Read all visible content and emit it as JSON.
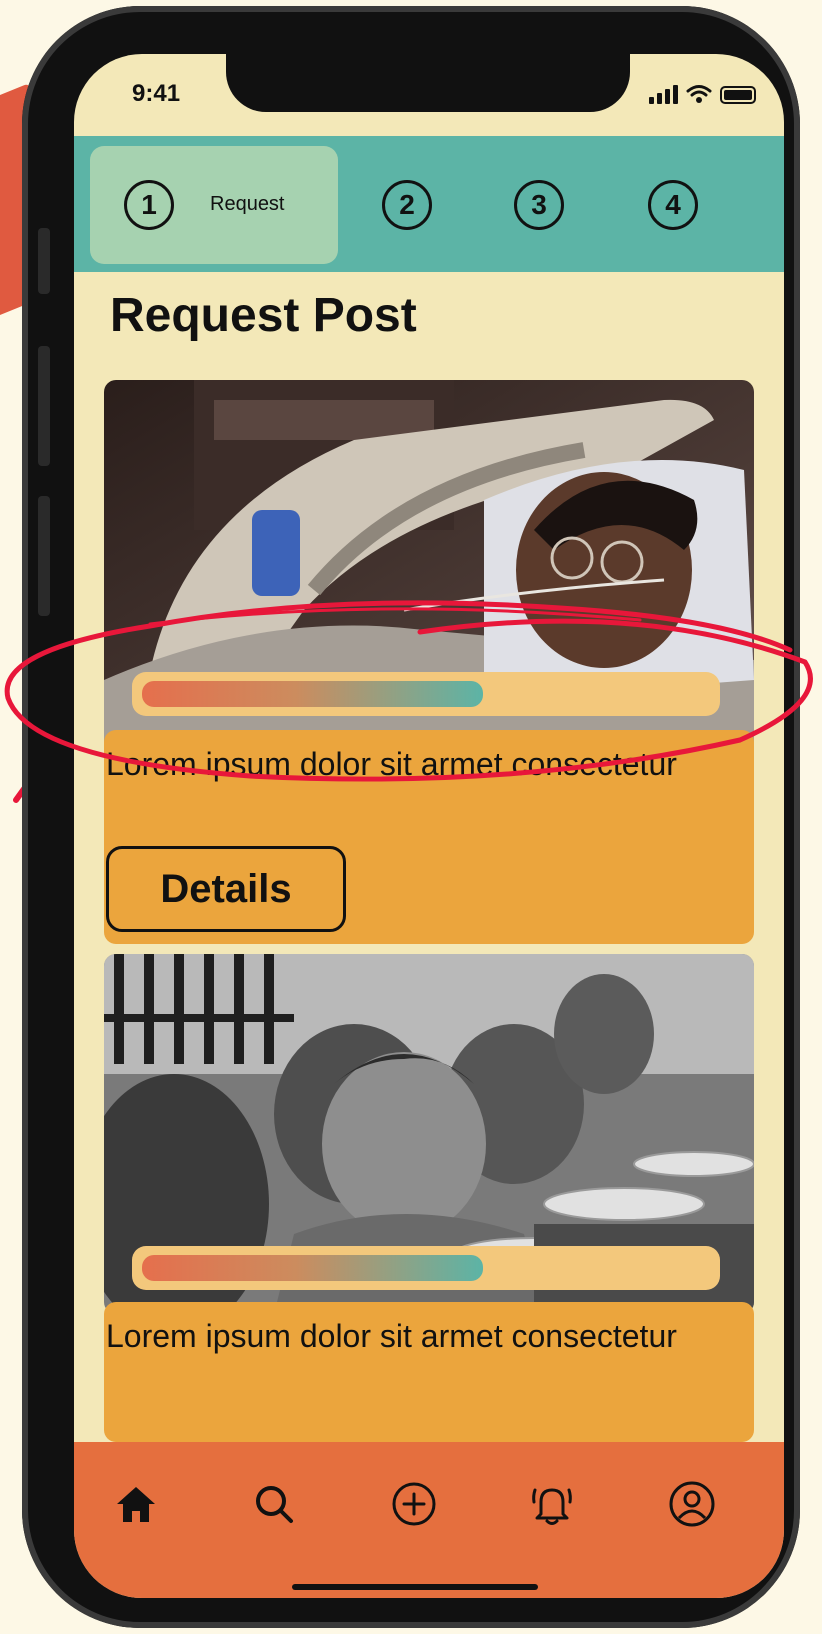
{
  "status_bar": {
    "time": "9:41"
  },
  "steps": [
    {
      "number": "1",
      "label": "Request",
      "active": true
    },
    {
      "number": "2"
    },
    {
      "number": "3"
    },
    {
      "number": "4"
    }
  ],
  "page_title": "Request Post",
  "posts": [
    {
      "description": "Lorem ipsum dolor sit armet consectetur",
      "details_label": "Details",
      "progress": 0.6
    },
    {
      "description": "Lorem ipsum dolor sit armet consectetur",
      "progress": 0.6
    }
  ],
  "bottom_nav": {
    "items": [
      {
        "icon": "home-icon",
        "active": true
      },
      {
        "icon": "search-icon"
      },
      {
        "icon": "add-circle-icon"
      },
      {
        "icon": "bell-icon"
      },
      {
        "icon": "profile-icon"
      }
    ]
  },
  "colors": {
    "screen_bg": "#F3E8B8",
    "step_bar": "#5CB4A6",
    "step_active": "#A6D2B0",
    "card": "#EBA53D",
    "progress_track": "#F3C87C",
    "nav_bar": "#E56F3E",
    "annotation": "#E8173A"
  }
}
